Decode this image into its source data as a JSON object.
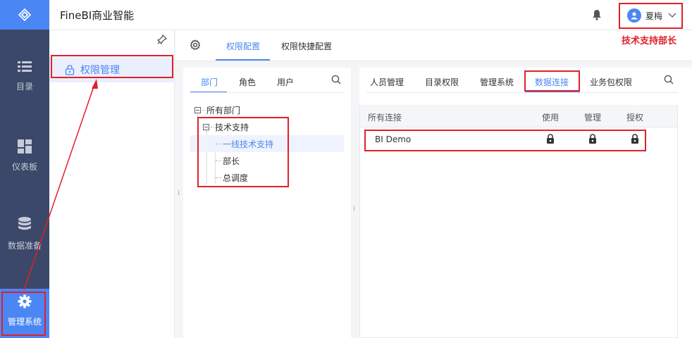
{
  "header": {
    "app_title": "FineBI商业智能",
    "user_name": "夏梅"
  },
  "nav": {
    "items": [
      {
        "label": "目录",
        "icon": "list-icon"
      },
      {
        "label": "仪表板",
        "icon": "dashboard-icon"
      },
      {
        "label": "数据准备",
        "icon": "database-icon"
      },
      {
        "label": "管理系统",
        "icon": "gear-icon",
        "active": true
      }
    ]
  },
  "sidebar": {
    "item": {
      "label": "权限管理",
      "icon": "lock-icon"
    }
  },
  "main_tabs": [
    {
      "label": "权限配置",
      "active": true
    },
    {
      "label": "权限快捷配置",
      "active": false
    }
  ],
  "left_panel": {
    "tabs": [
      {
        "label": "部门",
        "active": true
      },
      {
        "label": "角色",
        "active": false
      },
      {
        "label": "用户",
        "active": false
      }
    ],
    "tree": {
      "root": "所有部门",
      "child": "技术支持",
      "leaves": [
        {
          "label": "一线技术支持",
          "selected": true
        },
        {
          "label": "部长",
          "selected": false
        },
        {
          "label": "总调度",
          "selected": false
        }
      ]
    }
  },
  "right_panel": {
    "tabs": [
      {
        "label": "人员管理",
        "active": false
      },
      {
        "label": "目录权限",
        "active": false
      },
      {
        "label": "管理系统",
        "active": false
      },
      {
        "label": "数据连接",
        "active": true
      },
      {
        "label": "业务包权限",
        "active": false
      }
    ],
    "columns": [
      "所有连接",
      "使用",
      "管理",
      "授权"
    ],
    "rows": [
      {
        "name": "BI Demo",
        "use": "locked",
        "manage": "locked",
        "grant": "locked"
      }
    ]
  },
  "annotation": {
    "text": "技术支持部长",
    "color": "#e0202a"
  },
  "colors": {
    "accent": "#4b87f4",
    "nav_bg": "#3b4869",
    "annotation_red": "#e0202a"
  }
}
